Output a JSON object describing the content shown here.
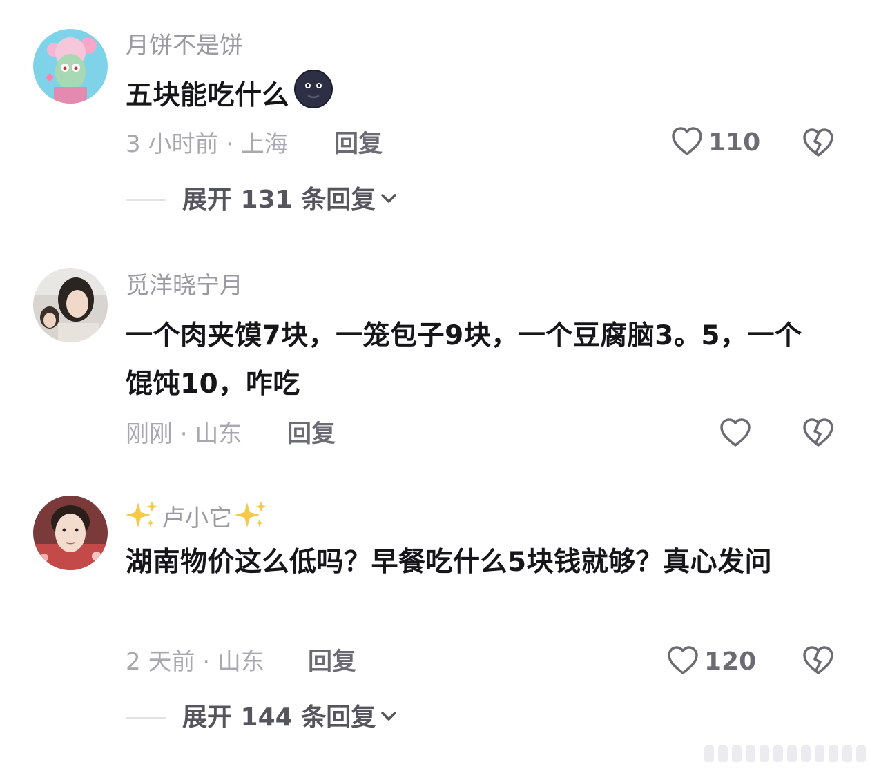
{
  "comments": [
    {
      "username": "月饼不是饼",
      "text": "五块能吃什么",
      "meta": "3 小时前 · 上海",
      "reply_label": "回复",
      "likes": "110",
      "expand_label": "展开 131 条回复"
    },
    {
      "username": "觅洋晓宁月",
      "text": "一个肉夹馍7块，一笼包子9块，一个豆腐脑3。5，一个馄饨10，咋吃",
      "meta": "刚刚 · 山东",
      "reply_label": "回复",
      "likes": ""
    },
    {
      "username": "卢小它",
      "text": "湖南物价这么低吗？早餐吃什么5块钱就够？真心发问",
      "meta": "2 天前 · 山东",
      "reply_label": "回复",
      "likes": "120",
      "expand_label": "展开 144 条回复"
    }
  ],
  "colors": {
    "username": "#9a9aa2",
    "text": "#16161a",
    "meta": "#a8a8b0",
    "action": "#6b6b73"
  },
  "icons": {
    "like": "heart-outline-icon",
    "dislike": "broken-heart-icon",
    "expand": "chevron-down-icon",
    "emoji": "new-moon-face-emoji",
    "sparkle": "sparkles-emoji"
  }
}
